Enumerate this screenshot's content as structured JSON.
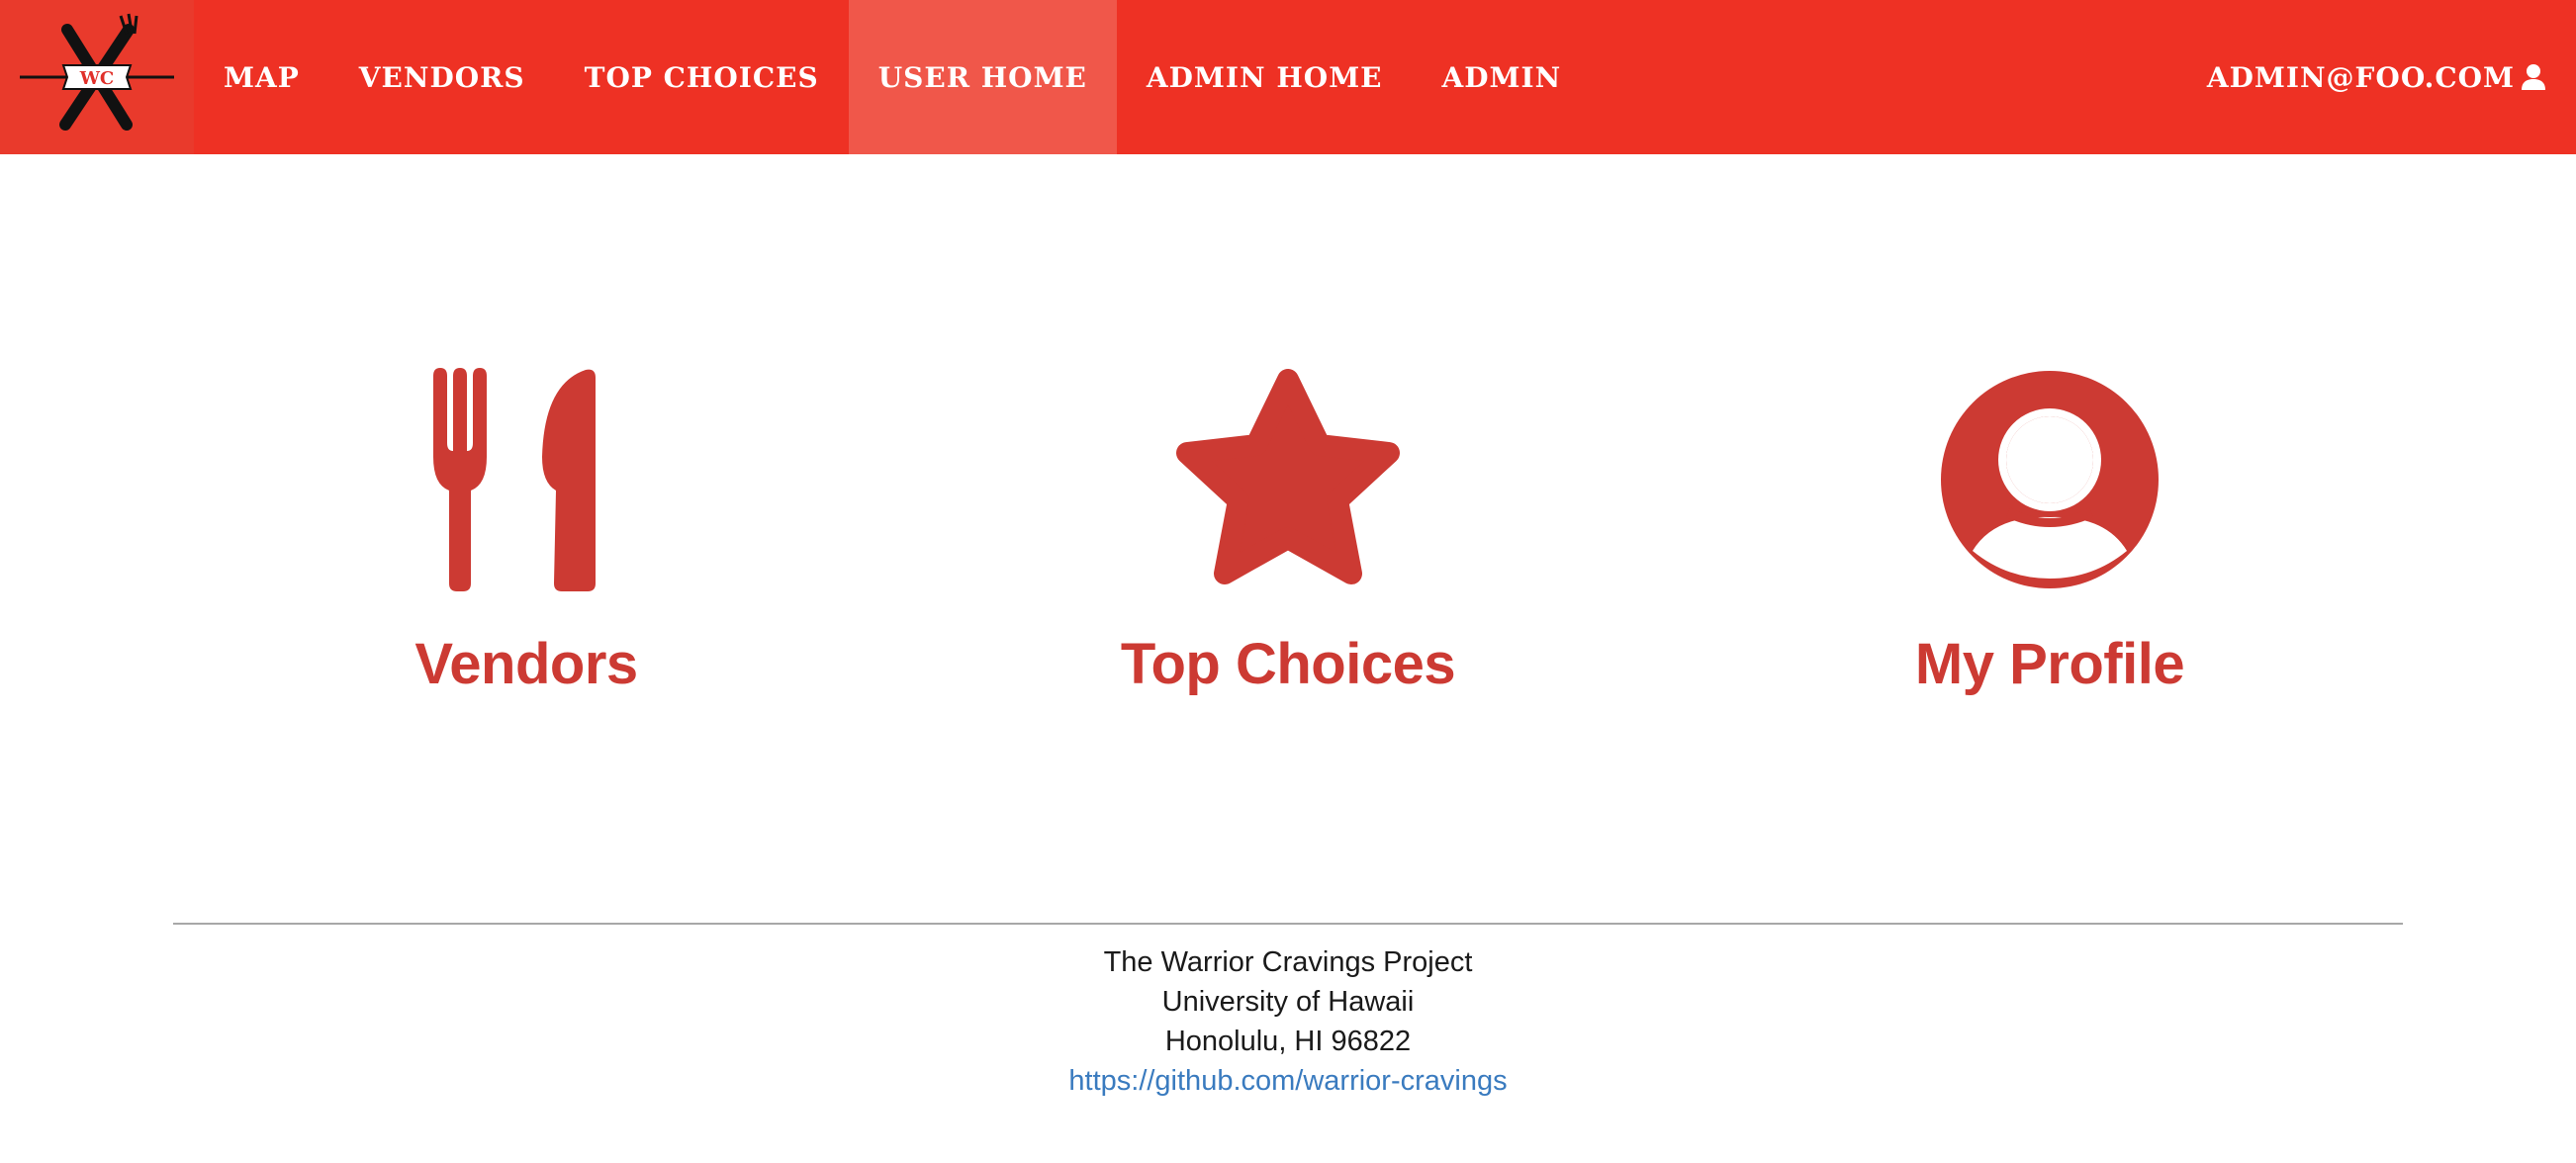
{
  "navbar": {
    "logo_text": "WC",
    "items": [
      {
        "label": "MAP",
        "active": false
      },
      {
        "label": "VENDORS",
        "active": false
      },
      {
        "label": "TOP CHOICES",
        "active": false
      },
      {
        "label": "USER HOME",
        "active": true
      },
      {
        "label": "ADMIN HOME",
        "active": false
      },
      {
        "label": "ADMIN",
        "active": false
      }
    ],
    "user_label": "ADMIN@FOO.COM",
    "user_icon": "user-icon"
  },
  "tiles": [
    {
      "label": "Vendors",
      "icon": "utensils-icon"
    },
    {
      "label": "Top Choices",
      "icon": "star-icon"
    },
    {
      "label": "My Profile",
      "icon": "user-circle-icon"
    }
  ],
  "footer": {
    "line1": "The Warrior Cravings Project",
    "line2": "University of Hawaii",
    "line3": "Honolulu, HI 96822",
    "link": "https://github.com/warrior-cravings"
  },
  "colors": {
    "navbar_bg": "#ee3124",
    "navbar_active": "#f0574a",
    "accent": "#cc3a33",
    "link": "#3a7bbf"
  }
}
